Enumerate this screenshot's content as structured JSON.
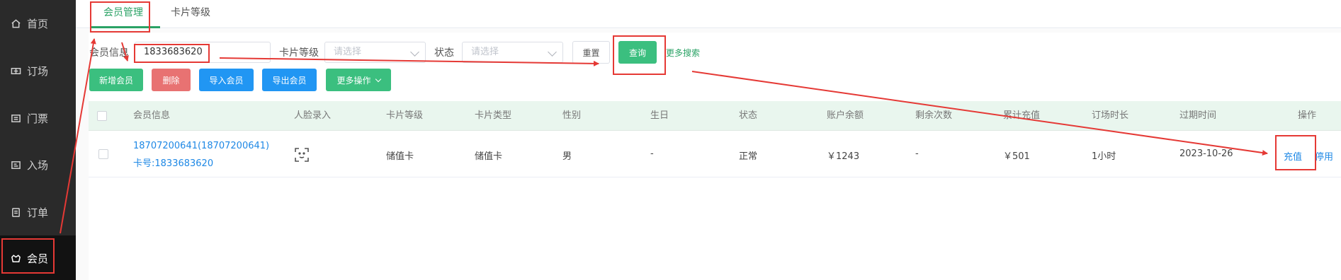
{
  "sidebar": {
    "items": [
      {
        "label": "首页",
        "icon": "home-icon"
      },
      {
        "label": "订场",
        "icon": "court-icon"
      },
      {
        "label": "门票",
        "icon": "ticket-icon"
      },
      {
        "label": "入场",
        "icon": "entry-icon"
      },
      {
        "label": "订单",
        "icon": "order-icon"
      },
      {
        "label": "会员",
        "icon": "member-icon",
        "active": true
      }
    ]
  },
  "tabs": [
    {
      "label": "会员管理",
      "active": true
    },
    {
      "label": "卡片等级",
      "active": false
    }
  ],
  "filter": {
    "member_info_label": "会员信息",
    "member_info_value": "1833683620",
    "card_level_label": "卡片等级",
    "card_level_placeholder": "请选择",
    "status_label": "状态",
    "status_placeholder": "请选择",
    "reset_label": "重置",
    "query_label": "查询",
    "more_search_label": "更多搜索"
  },
  "actions": {
    "add_member": "新增会员",
    "delete": "删除",
    "import_member": "导入会员",
    "export_member": "导出会员",
    "more_ops": "更多操作"
  },
  "table": {
    "columns": [
      "会员信息",
      "人脸录入",
      "卡片等级",
      "卡片类型",
      "性别",
      "生日",
      "状态",
      "账户余额",
      "剩余次数",
      "累计充值",
      "订场时长",
      "过期时间",
      "操作"
    ],
    "rows": [
      {
        "member_name": "18707200641(18707200641)",
        "card_no": "卡号:1833683620",
        "card_level": "储值卡",
        "card_type": "储值卡",
        "gender": "男",
        "birthday": "-",
        "status": "正常",
        "balance": "￥1243",
        "remaining_times": "-",
        "total_recharge": "￥501",
        "booking_duration": "1小时",
        "expire_time": "2023-10-26",
        "op_recharge": "充值",
        "op_disable": "停用"
      }
    ]
  },
  "colors": {
    "primary_green": "#3bbf7f",
    "danger_red": "#e87272",
    "blue": "#2196f3",
    "annotation_red": "#e53935"
  }
}
